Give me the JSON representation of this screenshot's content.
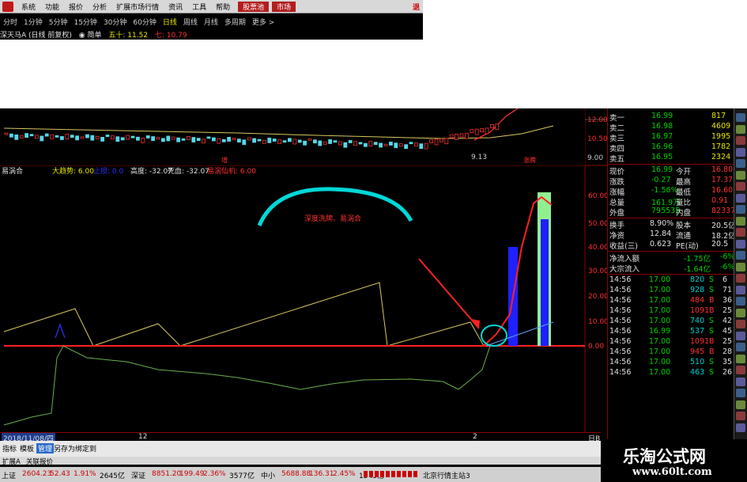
{
  "menu": {
    "items": [
      "系统",
      "功能",
      "报价",
      "分析",
      "扩展市场行情",
      "资讯",
      "工具",
      "帮助"
    ],
    "highlight": [
      "股票池",
      "市场"
    ],
    "close_label": "退"
  },
  "periods": [
    "分时",
    "1分钟",
    "5分钟",
    "15分钟",
    "30分钟",
    "60分钟",
    "日线",
    "周线",
    "月线",
    "多周期",
    "更多 >"
  ],
  "active_period": "日线",
  "stock": {
    "name": "深天马A (日线 前复权)",
    "ma_label": "◉ 简单",
    "ma_value": "五十: 11.52",
    "ma2": "七: 10.79"
  },
  "kline": {
    "price_ticks": [
      "12.00",
      "10.50",
      "9.00"
    ],
    "low_label": "9.13",
    "mark1": "增",
    "mark2": "涨腾"
  },
  "indicator": {
    "name": "易涡合",
    "labels": [
      "大趋势: 6.00",
      "止损: 0.0",
      "高度: -32.07",
      "死血: -32.07",
      "易涡仙机: 6.00"
    ],
    "ticks": [
      "60.00",
      "50.00",
      "40.00",
      "30.00",
      "20.00",
      "10.00",
      "0.00"
    ],
    "annotation": "深度洗牌、易涡合"
  },
  "quote": {
    "asks": [
      {
        "label": "卖一",
        "price": "16.99",
        "vol": "817"
      },
      {
        "label": "卖二",
        "price": "16.98",
        "vol": "4609"
      },
      {
        "label": "卖三",
        "price": "16.97",
        "vol": "1995"
      },
      {
        "label": "卖四",
        "price": "16.96",
        "vol": "1782"
      },
      {
        "label": "卖五",
        "price": "16.95",
        "vol": "2324"
      }
    ],
    "stats": [
      {
        "k1": "现价",
        "v1": "16.99",
        "k2": "今开",
        "v2": "16.80"
      },
      {
        "k1": "涨跌",
        "v1": "-0.27",
        "k2": "最高",
        "v2": "17.37"
      },
      {
        "k1": "涨幅",
        "v1": "-1.56%",
        "k2": "最低",
        "v2": "16.60"
      },
      {
        "k1": "总量",
        "v1": "161.9万",
        "k2": "量比",
        "v2": "0.91"
      },
      {
        "k1": "外盘",
        "v1": "795535",
        "k2": "内盘",
        "v2": "823374"
      }
    ],
    "stats2": [
      {
        "k1": "换手",
        "v1": "8.90%",
        "k2": "股本",
        "v2": "20.5亿"
      },
      {
        "k1": "净资",
        "v1": "12.84",
        "k2": "流通",
        "v2": "18.2亿"
      },
      {
        "k1": "收益(三)",
        "v1": "0.623",
        "k2": "PE(动)",
        "v2": "20.5"
      }
    ],
    "flows": [
      {
        "k": "净流入额",
        "v": "-1.75亿",
        "p": "-6%"
      },
      {
        "k": "大宗流入",
        "v": "-1.64亿",
        "p": "-6%"
      }
    ],
    "ticks": [
      {
        "t": "14:56",
        "p": "17.00",
        "v": "820",
        "s": "S",
        "n": "6"
      },
      {
        "t": "14:56",
        "p": "17.00",
        "v": "928",
        "s": "S",
        "n": "71"
      },
      {
        "t": "14:56",
        "p": "17.00",
        "v": "484",
        "s": "B",
        "n": "36"
      },
      {
        "t": "14:56",
        "p": "17.00",
        "v": "1091",
        "s": "B",
        "n": "25"
      },
      {
        "t": "14:56",
        "p": "17.00",
        "v": "740",
        "s": "S",
        "n": "42"
      },
      {
        "t": "14:56",
        "p": "16.99",
        "v": "537",
        "s": "S",
        "n": "45"
      },
      {
        "t": "14:56",
        "p": "17.00",
        "v": "1091",
        "s": "B",
        "n": "25"
      },
      {
        "t": "14:56",
        "p": "17.00",
        "v": "945",
        "s": "B",
        "n": "28"
      },
      {
        "t": "14:56",
        "p": "17.00",
        "v": "510",
        "s": "S",
        "n": "35"
      },
      {
        "t": "14:56",
        "p": "17.00",
        "v": "463",
        "s": "S",
        "n": "26"
      }
    ]
  },
  "date_bar": {
    "date": "2018/11/08/四",
    "m1": "12",
    "m2": "2",
    "end": "日B"
  },
  "tabs": {
    "items": [
      "指标",
      "模板",
      "管理",
      "另存为",
      "绑定到"
    ],
    "ext": [
      "扩展A",
      "关联报价"
    ]
  },
  "status": {
    "items": [
      {
        "label": "上证",
        "val": "2604.23",
        "chg": "52.43",
        "pct": "1.91%",
        "amt": "2645亿"
      },
      {
        "label": "深证",
        "val": "8851.20",
        "chg": "199.49",
        "pct": "2.36%",
        "amt": "3577亿"
      },
      {
        "label": "中小",
        "val": "5688.88",
        "chg": "136.31",
        "pct": "2.45%",
        "amt": "1543亿"
      }
    ],
    "server": "北京行情主站3"
  },
  "watermark": {
    "title": "乐淘公式网",
    "url": "www.60lt.com"
  },
  "colors": {
    "up": "#ff3030",
    "down": "#00d000",
    "yellow": "#e6e600",
    "cyan": "#00d0d0",
    "frame": "#8b0000"
  }
}
